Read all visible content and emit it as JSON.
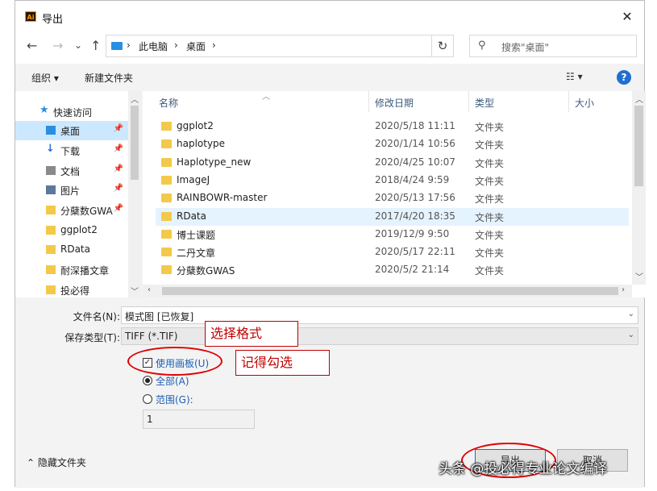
{
  "window": {
    "title": "导出",
    "app_icon_text": "Ai",
    "close_symbol": "✕"
  },
  "nav": {
    "back": "←",
    "forward": "→",
    "recent": "⌄",
    "up": "↑",
    "breadcrumb": [
      "此电脑",
      "桌面"
    ],
    "sep": "›",
    "refresh": "↻",
    "search_placeholder": "搜索\"桌面\""
  },
  "toolbar": {
    "organize": "组织 ▾",
    "new_folder": "新建文件夹",
    "view_symbol": "☷ ▾",
    "help": "?"
  },
  "sidebar": {
    "items": [
      {
        "label": "快速访问",
        "icon": "star-icon",
        "color": "#2a8ee3",
        "pinned": false
      },
      {
        "label": "桌面",
        "icon": "desktop-icon",
        "color": "#2a8ee3",
        "pinned": true,
        "selected": true
      },
      {
        "label": "下载",
        "icon": "download-icon",
        "color": "#2a6fd1",
        "pinned": true
      },
      {
        "label": "文档",
        "icon": "document-icon",
        "color": "#8a8a8a",
        "pinned": true
      },
      {
        "label": "图片",
        "icon": "picture-icon",
        "color": "#5a7a9a",
        "pinned": true
      },
      {
        "label": "分蘖数GWA",
        "icon": "folder-icon",
        "color": "#f3c94a",
        "pinned": true
      },
      {
        "label": "ggplot2",
        "icon": "folder-icon",
        "color": "#f3c94a",
        "pinned": false
      },
      {
        "label": "RData",
        "icon": "folder-icon",
        "color": "#f3c94a",
        "pinned": false
      },
      {
        "label": "耐深播文章",
        "icon": "folder-icon",
        "color": "#f3c94a",
        "pinned": false
      },
      {
        "label": "投必得",
        "icon": "folder-icon",
        "color": "#f3c94a",
        "pinned": false
      }
    ],
    "pin_symbol": "📌"
  },
  "columns": {
    "name": "名称",
    "date": "修改日期",
    "type": "类型",
    "size": "大小"
  },
  "files": [
    {
      "name": "ggplot2",
      "date": "2020/5/18 11:11",
      "type": "文件夹"
    },
    {
      "name": "haplotype",
      "date": "2020/1/14 10:56",
      "type": "文件夹"
    },
    {
      "name": "Haplotype_new",
      "date": "2020/4/25 10:07",
      "type": "文件夹"
    },
    {
      "name": "ImageJ",
      "date": "2018/4/24 9:59",
      "type": "文件夹"
    },
    {
      "name": "RAINBOWR-master",
      "date": "2020/5/13 17:56",
      "type": "文件夹"
    },
    {
      "name": "RData",
      "date": "2017/4/20 18:35",
      "type": "文件夹",
      "selected": true
    },
    {
      "name": "博士课题",
      "date": "2019/12/9 9:50",
      "type": "文件夹"
    },
    {
      "name": "二丹文章",
      "date": "2020/5/17 22:11",
      "type": "文件夹"
    },
    {
      "name": "分蘖数GWAS",
      "date": "2020/5/2 21:14",
      "type": "文件夹"
    }
  ],
  "form": {
    "filename_label": "文件名(N):",
    "filename_value": "模式图 [已恢复]",
    "filetype_label": "保存类型(T):",
    "filetype_value": "TIFF (*.TIF)",
    "use_artboard": "使用画板(U)",
    "use_artboard_checked": true,
    "all_label": "全部(A)",
    "range_label": "范围(G):",
    "range_value": "1",
    "hide_folders": "隐藏文件夹",
    "export_button": "导出",
    "cancel_button": "取消"
  },
  "annotations": {
    "choose_format": "选择格式",
    "remember_check": "记得勾选",
    "color": "#c00000"
  },
  "watermark": "头条 @投必得专业论文编译"
}
